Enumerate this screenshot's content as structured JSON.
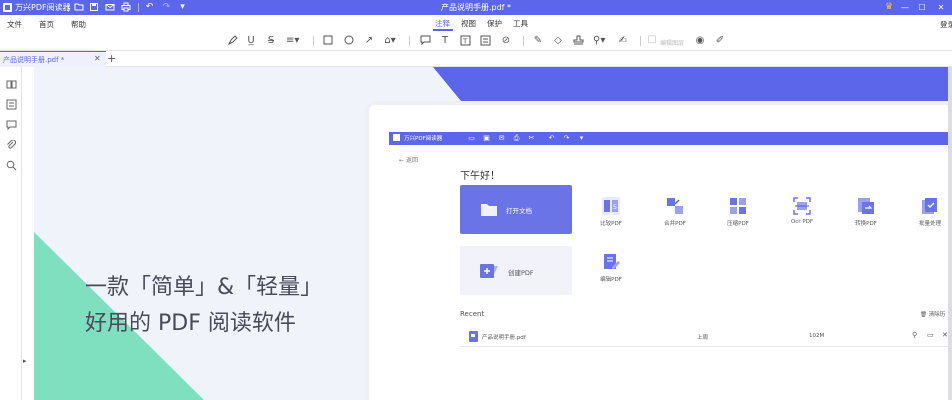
{
  "titlebar": {
    "app_name": "万兴PDF阅读器",
    "document_title": "产品说明手册.pdf *"
  },
  "menu": {
    "file": "文件",
    "home": "首页",
    "help": "帮助",
    "tabs": [
      "注释",
      "视图",
      "保护",
      "工具"
    ],
    "active_tab": "注释",
    "login": "登录"
  },
  "toolbar": {
    "disabled_label": "编辑图层"
  },
  "doc_tab": {
    "label": "产品说明手册.pdf *"
  },
  "page": {
    "headline_1": "一款「简单」&「轻量」",
    "headline_2": "好用的 PDF 阅读软件"
  },
  "inner_app": {
    "app_name": "万兴PDF阅读器",
    "back": "返回",
    "greeting": "下午好！",
    "open_doc": "打开文档",
    "create_pdf": "创建PDF",
    "tools": [
      {
        "label": "比较PDF"
      },
      {
        "label": "合并PDF"
      },
      {
        "label": "压缩PDF"
      },
      {
        "label": "Ocr PDF"
      },
      {
        "label": "转换PDF"
      },
      {
        "label": "批量处理"
      }
    ],
    "edit_pdf": "编辑PDF",
    "recent": "Recent",
    "clear": "清除历",
    "recent_file": {
      "name": "产品说明手册.pdf",
      "time": "上周",
      "size": "102M"
    }
  },
  "colors": {
    "accent": "#5b66ea",
    "green": "#7fe0bf",
    "page_bg": "#f0f3f9"
  }
}
